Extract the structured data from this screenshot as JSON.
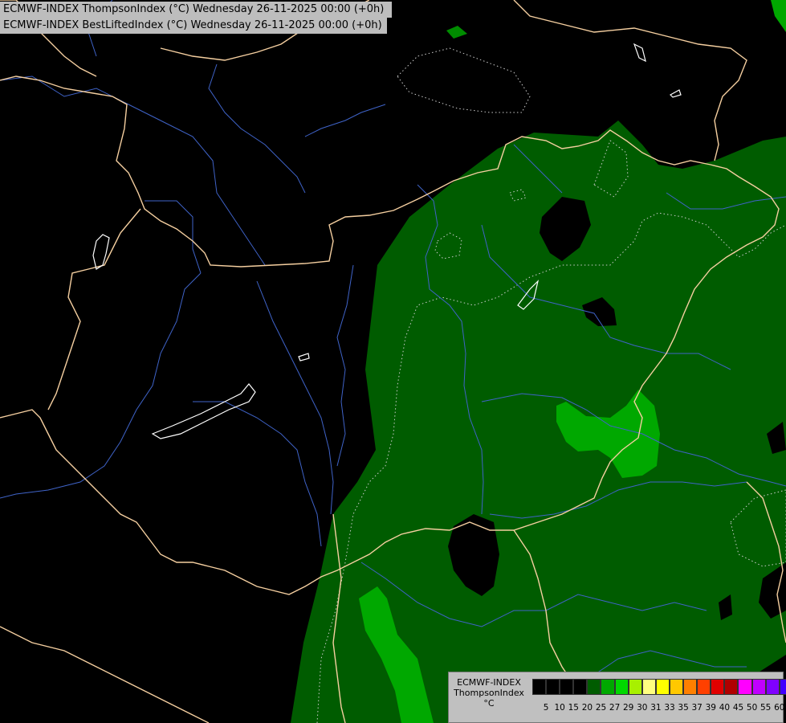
{
  "titles": {
    "line1": "ECMWF-INDEX ThompsonIndex (°C) Wednesday 26-11-2025 00:00 (+0h)",
    "line2": "ECMWF-INDEX BestLiftedIndex (°C) Wednesday 26-11-2025 00:00 (+0h)"
  },
  "colors": {
    "background": "#000000",
    "border": "#f5cfa0",
    "river": "#3f63c8",
    "lake_outline": "#ffffff",
    "dark_green": "#005c00",
    "mid_green": "#008c00",
    "bright_green": "#00b800",
    "contour": "#cccccc"
  },
  "legend": {
    "title_line1": "ECMWF-INDEX",
    "title_line2": "ThompsonIndex",
    "title_line3": "°C",
    "swatch_colors": [
      "#000000",
      "#000000",
      "#000000",
      "#000000",
      "#005c00",
      "#00a800",
      "#00d800",
      "#a8f000",
      "#ffff80",
      "#ffff00",
      "#ffc800",
      "#ff8000",
      "#ff4000",
      "#e00000",
      "#b00000",
      "#ff00ff",
      "#c000ff",
      "#8000ff",
      "#4000ff",
      "#0000ff"
    ],
    "tick_labels": [
      "5",
      "10",
      "15",
      "20",
      "25",
      "27",
      "29",
      "30",
      "31",
      "33",
      "35",
      "37",
      "39",
      "40",
      "45",
      "50",
      "55",
      "60"
    ]
  }
}
